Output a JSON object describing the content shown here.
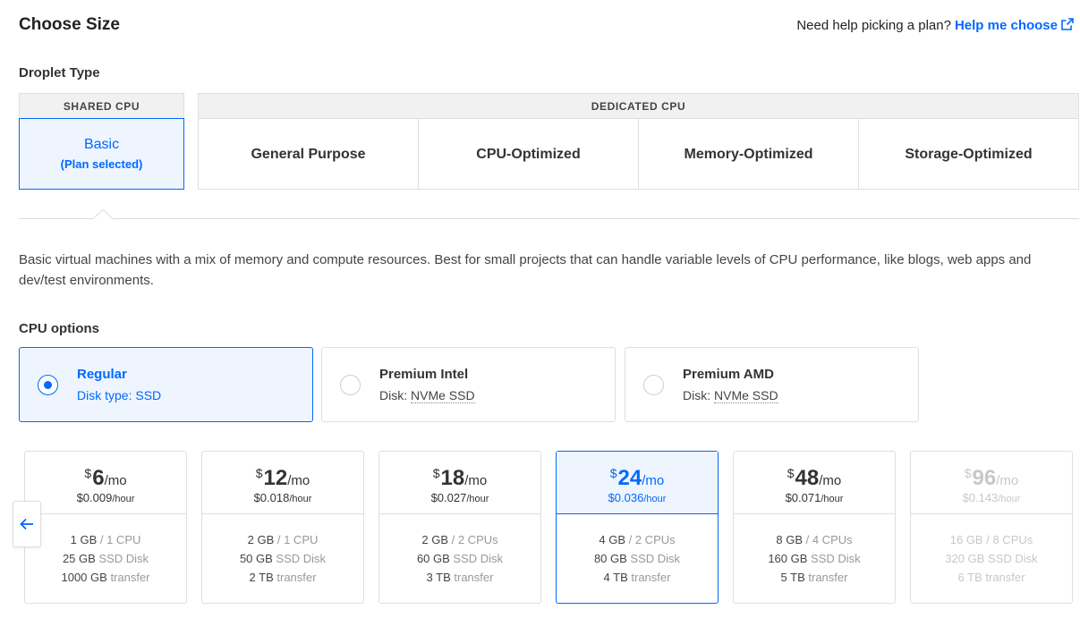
{
  "header": {
    "title": "Choose Size",
    "help_text": "Need help picking a plan?",
    "help_link": "Help me choose"
  },
  "droplet_type": {
    "label": "Droplet Type",
    "shared_heading": "SHARED CPU",
    "basic_label": "Basic",
    "basic_status": "(Plan selected)",
    "dedicated_heading": "DEDICATED CPU",
    "dedicated_options": [
      "General Purpose",
      "CPU-Optimized",
      "Memory-Optimized",
      "Storage-Optimized"
    ]
  },
  "description": "Basic virtual machines with a mix of memory and compute resources. Best for small projects that can handle variable levels of CPU performance, like blogs, web apps and dev/test environments.",
  "cpu_options": {
    "label": "CPU options",
    "items": [
      {
        "name": "Regular",
        "disk_prefix": "Disk type:",
        "disk_value": "SSD",
        "selected": true
      },
      {
        "name": "Premium Intel",
        "disk_prefix": "Disk:",
        "disk_value": "NVMe SSD",
        "selected": false
      },
      {
        "name": "Premium AMD",
        "disk_prefix": "Disk:",
        "disk_value": "NVMe SSD",
        "selected": false
      }
    ]
  },
  "plans": {
    "prev_icon": "arrow-left-icon",
    "currency": "$",
    "per_month": "/mo",
    "per_hour": "/hour",
    "items": [
      {
        "monthly": "6",
        "hourly": "$0.009",
        "memory": "1 GB",
        "cpu": "/ 1 CPU",
        "disk": "25 GB",
        "disk_label": "SSD Disk",
        "transfer": "1000 GB",
        "transfer_label": "transfer",
        "state": "normal"
      },
      {
        "monthly": "12",
        "hourly": "$0.018",
        "memory": "2 GB",
        "cpu": "/ 1 CPU",
        "disk": "50 GB",
        "disk_label": "SSD Disk",
        "transfer": "2 TB",
        "transfer_label": "transfer",
        "state": "normal"
      },
      {
        "monthly": "18",
        "hourly": "$0.027",
        "memory": "2 GB",
        "cpu": "/ 2 CPUs",
        "disk": "60 GB",
        "disk_label": "SSD Disk",
        "transfer": "3 TB",
        "transfer_label": "transfer",
        "state": "normal"
      },
      {
        "monthly": "24",
        "hourly": "$0.036",
        "memory": "4 GB",
        "cpu": "/ 2 CPUs",
        "disk": "80 GB",
        "disk_label": "SSD Disk",
        "transfer": "4 TB",
        "transfer_label": "transfer",
        "state": "selected"
      },
      {
        "monthly": "48",
        "hourly": "$0.071",
        "memory": "8 GB",
        "cpu": "/ 4 CPUs",
        "disk": "160 GB",
        "disk_label": "SSD Disk",
        "transfer": "5 TB",
        "transfer_label": "transfer",
        "state": "normal"
      },
      {
        "monthly": "96",
        "hourly": "$0.143",
        "memory": "16 GB",
        "cpu": "/ 8 CPUs",
        "disk": "320 GB",
        "disk_label": "SSD Disk",
        "transfer": "6 TB",
        "transfer_label": "transfer",
        "state": "disabled"
      }
    ]
  },
  "colors": {
    "accent": "#0069ff",
    "selected_bg": "#eef5ff",
    "border": "#dfdfdf"
  }
}
